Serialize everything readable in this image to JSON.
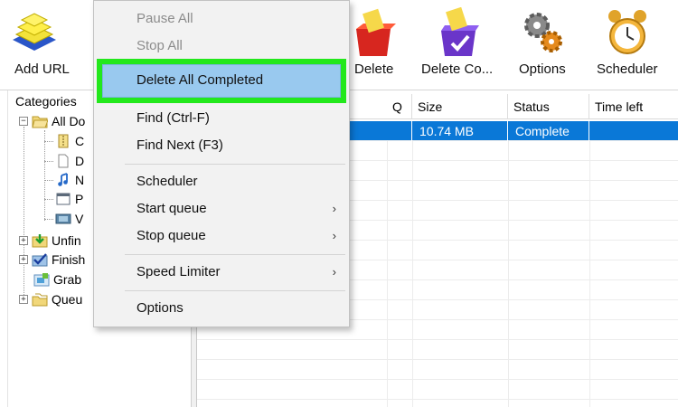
{
  "toolbar": {
    "add_url": "Add URL",
    "delete": "Delete",
    "delete_completed": "Delete Co...",
    "options": "Options",
    "scheduler": "Scheduler"
  },
  "categories": {
    "header": "Categories",
    "all_downloads": "All Do",
    "sub": [
      "C",
      "D",
      "N",
      "P",
      "V"
    ],
    "unfinished": "Unfin",
    "finished": "Finish",
    "grabber": "Grab",
    "queues": "Queu"
  },
  "list": {
    "columns": [
      "Q",
      "Size",
      "Status",
      "Time left"
    ],
    "rows": [
      {
        "q": "",
        "size": "10.74  MB",
        "status": "Complete",
        "time_left": ""
      }
    ]
  },
  "menu": {
    "items": [
      {
        "label": "Pause All",
        "disabled": true
      },
      {
        "label": "Stop All",
        "disabled": true
      },
      {
        "label": "Delete All Completed",
        "highlighted": true
      },
      {
        "label": "Find (Ctrl-F)"
      },
      {
        "label": "Find Next (F3)"
      },
      {
        "label": "Scheduler"
      },
      {
        "label": "Start queue",
        "submenu": true
      },
      {
        "label": "Stop queue",
        "submenu": true
      },
      {
        "label": "Speed Limiter",
        "submenu": true
      },
      {
        "label": "Options"
      }
    ],
    "submenu_arrow": "›"
  },
  "colors": {
    "selection": "#0a78d7",
    "highlight_outline": "#23e81c",
    "menu_hover": "#99c9ef"
  }
}
